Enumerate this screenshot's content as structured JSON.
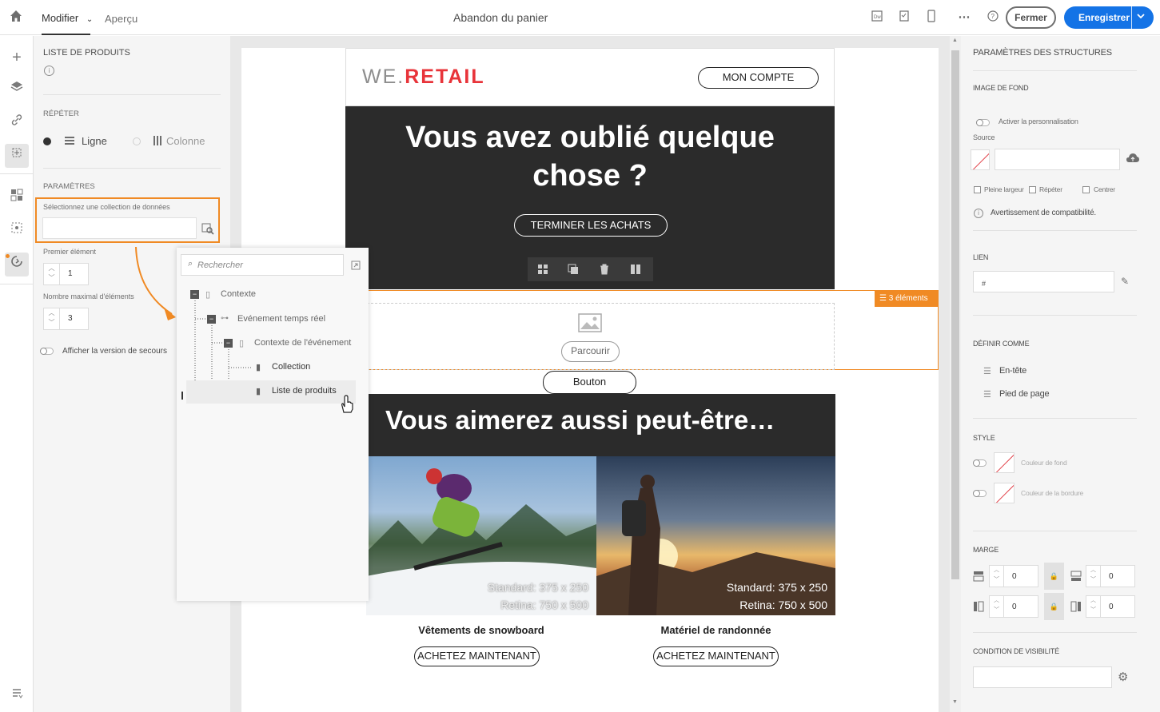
{
  "topbar": {
    "tab_edit": "Modifier",
    "tab_preview": "Aperçu",
    "title": "Abandon du panier",
    "close_label": "Fermer",
    "save_label": "Enregistrer"
  },
  "left_panel": {
    "section_title": "LISTE DE PRODUITS",
    "repeat_label": "RÉPÉTER",
    "repeat_row": "Ligne",
    "repeat_column": "Colonne",
    "params_label": "PARAMÈTRES",
    "collection_label": "Sélectionnez une collection de données",
    "collection_value": "",
    "first_item_label": "Premier élément",
    "first_item_value": "1",
    "max_items_label": "Nombre maximal d'éléments",
    "max_items_value": "3",
    "fallback_label": "Afficher la version de secours"
  },
  "popup": {
    "search_placeholder": "Rechercher",
    "tree": [
      {
        "label": "Contexte"
      },
      {
        "label": "Evénement temps réel"
      },
      {
        "label": "Contexte de l'événement"
      },
      {
        "label": "Collection"
      },
      {
        "label": "Liste de produits"
      }
    ]
  },
  "email": {
    "brand_prefix": "WE.",
    "brand_suffix": "RETAIL",
    "account_button": "MON COMPTE",
    "hero_title": "Vous avez oublié quelque chose ?",
    "hero_button": "TERMINER LES ACHATS",
    "items_badge": "3 éléments",
    "browse_button": "Parcourir",
    "button_label": "Bouton",
    "section2_title": "Vous aimerez aussi peut-être…",
    "products": [
      {
        "name": "Vêtements de snowboard",
        "cta": "ACHETEZ MAINTENANT",
        "img_line1": "Standard: 375 x 250",
        "img_line2": "Retina: 750 x 500"
      },
      {
        "name": "Matériel de randonnée",
        "cta": "ACHETEZ MAINTENANT",
        "img_line1": "Standard: 375 x 250",
        "img_line2": "Retina: 750 x 500"
      }
    ]
  },
  "right_panel": {
    "title": "PARAMÈTRES DES STRUCTURES",
    "bg_image": "IMAGE DE FOND",
    "personalize": "Activer la personnalisation",
    "source": "Source",
    "full_width": "Pleine largeur",
    "repeat": "Répéter",
    "center": "Centrer",
    "compat": "Avertissement de compatibilité.",
    "link": "LIEN",
    "link_value": "#",
    "define_as": "DÉFINIR COMME",
    "header": "En-tête",
    "footer": "Pied de page",
    "style": "STYLE",
    "bg_color": "Couleur de fond",
    "border_color": "Couleur de la bordure",
    "margin": "MARGE",
    "margin_top": "0",
    "margin_bottom": "0",
    "margin_left": "0",
    "margin_right": "0",
    "visibility": "CONDITION DE VISIBILITÉ"
  },
  "colors": {
    "accent": "#1473e6",
    "orange": "#f08a24",
    "brand_red": "#e8343a",
    "dark": "#2b2b2b"
  }
}
